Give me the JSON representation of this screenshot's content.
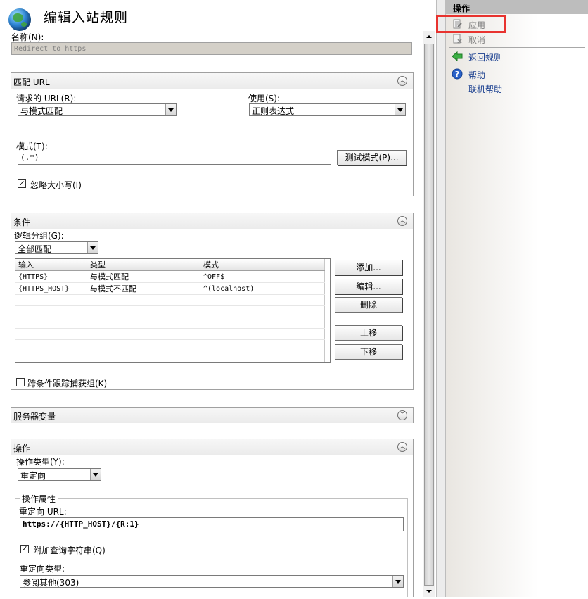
{
  "page": {
    "title": "编辑入站规则",
    "name_label": "名称(N):",
    "name_value": "Redirect to https"
  },
  "match_url": {
    "header": "匹配 URL",
    "requested_url_label": "请求的 URL(R):",
    "requested_url_value": "与模式匹配",
    "using_label": "使用(S):",
    "using_value": "正则表达式",
    "pattern_label": "模式(T):",
    "pattern_value": "(.*)",
    "test_pattern_button": "测试模式(P)...",
    "ignore_case_label": "忽略大小写(I)",
    "ignore_case_checked": true
  },
  "conditions": {
    "header": "条件",
    "logical_grouping_label": "逻辑分组(G):",
    "logical_grouping_value": "全部匹配",
    "columns": [
      "输入",
      "类型",
      "模式"
    ],
    "rows": [
      {
        "input": "{HTTPS}",
        "type": "与模式匹配",
        "pattern": "^OFF$"
      },
      {
        "input": "{HTTPS_HOST}",
        "type": "与模式不匹配",
        "pattern": "^(localhost)"
      }
    ],
    "buttons": {
      "add": "添加...",
      "edit": "编辑...",
      "remove": "删除",
      "move_up": "上移",
      "move_down": "下移"
    },
    "track_captures_label": "跨条件跟踪捕获组(K)",
    "track_captures_checked": false
  },
  "server_variables": {
    "header": "服务器变量"
  },
  "action": {
    "header": "操作",
    "action_type_label": "操作类型(Y):",
    "action_type_value": "重定向",
    "properties_label": "操作属性",
    "redirect_url_label": "重定向 URL:",
    "redirect_url_value": "https://{HTTP_HOST}/{R:1}",
    "append_query_label": "附加查询字符串(Q)",
    "append_query_checked": true,
    "redirect_type_label": "重定向类型:",
    "redirect_type_value": "参阅其他(303)"
  },
  "actions_panel": {
    "header": "操作",
    "apply": "应用",
    "cancel": "取消",
    "back_to_rules": "返回规则",
    "help": "帮助",
    "online_help": "联机帮助"
  },
  "colors": {
    "highlight": "#e8332f",
    "link": "#1a3f8f",
    "disabled": "#808080"
  }
}
